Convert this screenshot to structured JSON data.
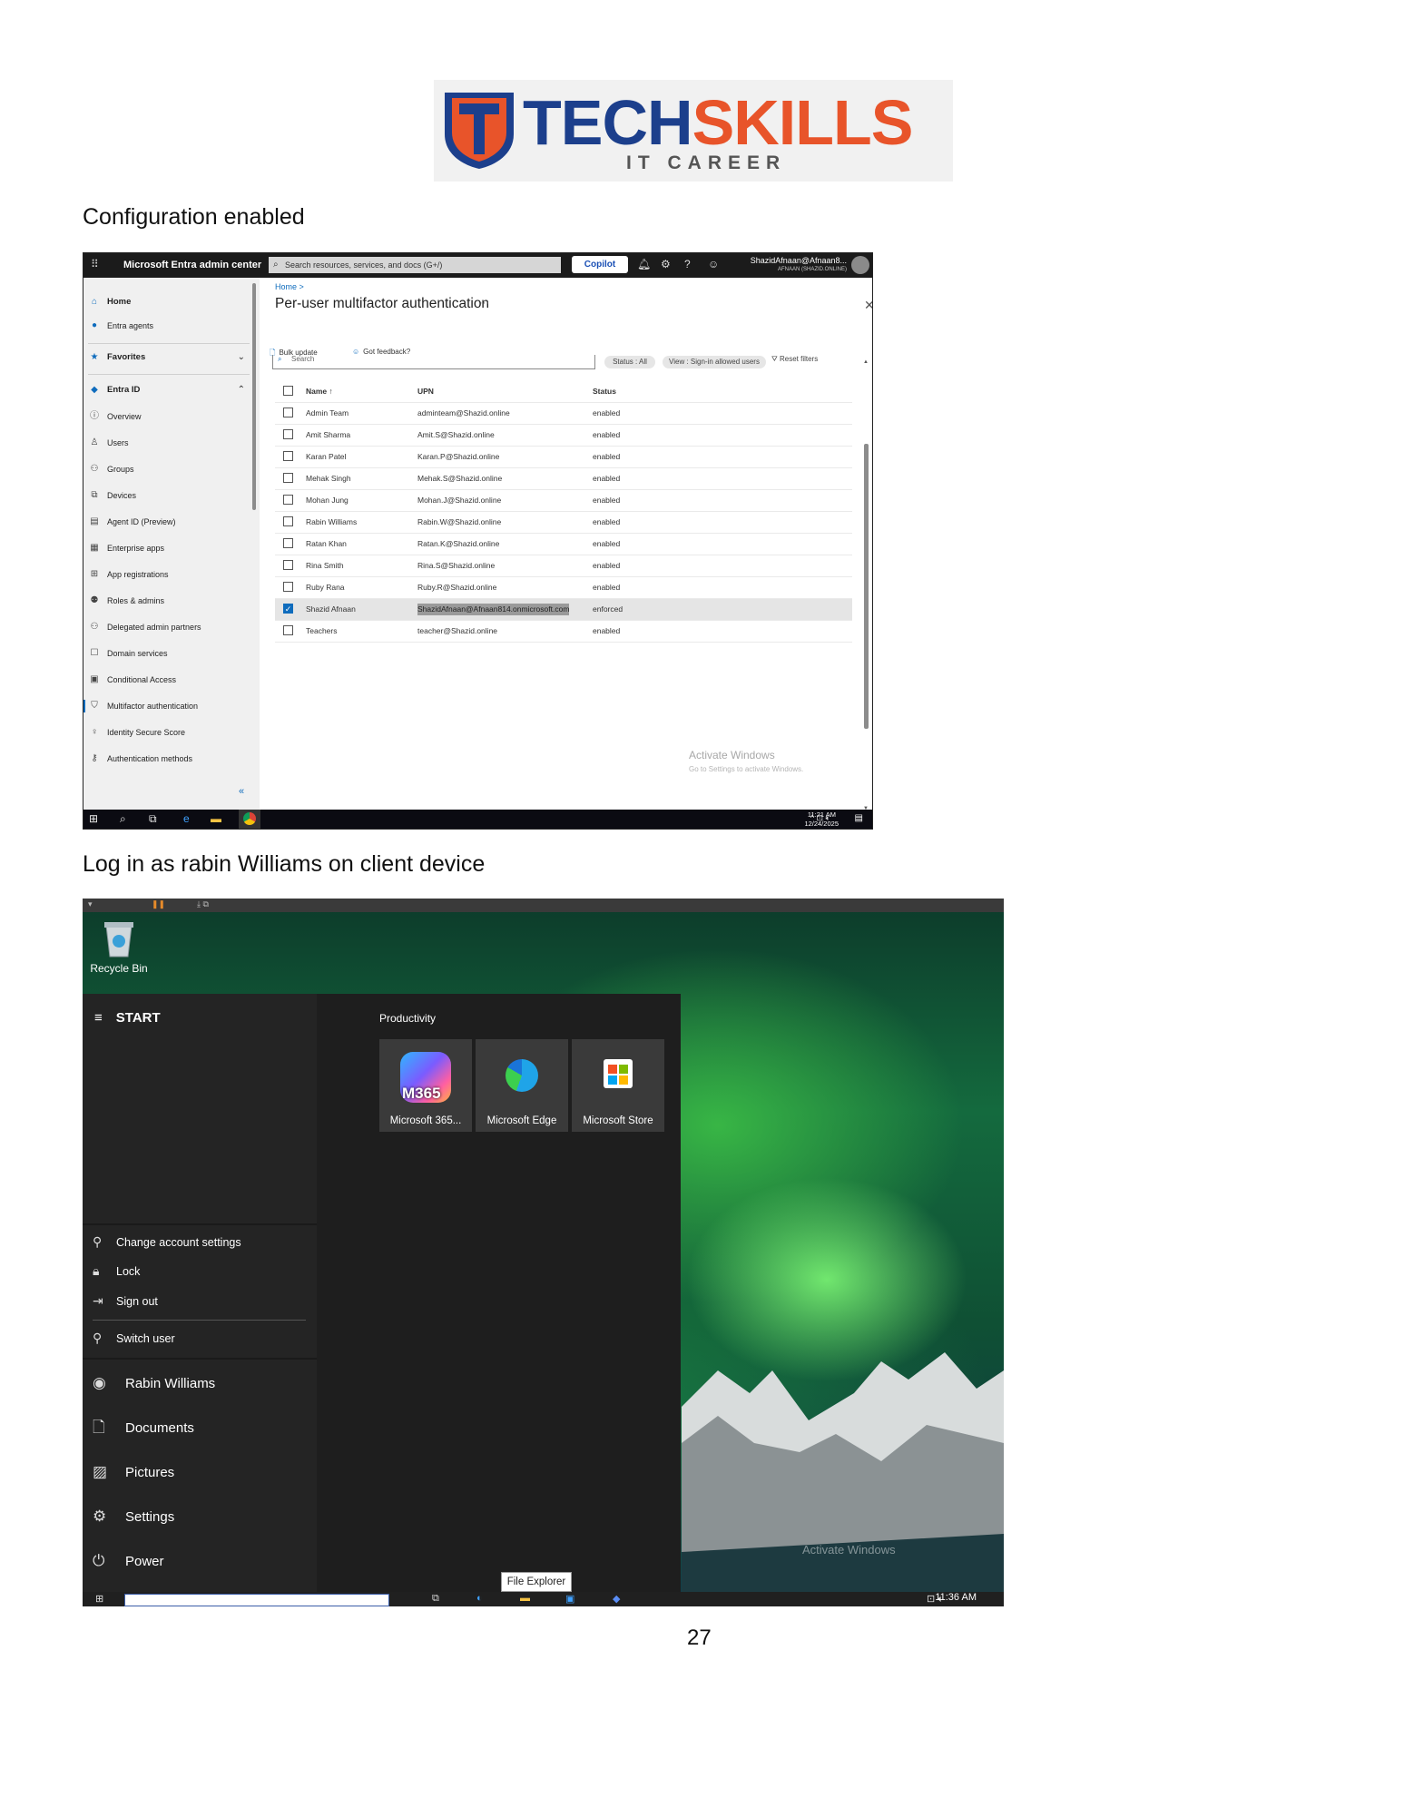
{
  "logo": {
    "word1": "TECH",
    "word2": "SKILLS",
    "tagline": "IT CAREER"
  },
  "heading1": "Configuration enabled",
  "heading2": "Log in as rabin Williams on client device",
  "page_number": "27",
  "entra": {
    "app_title": "Microsoft Entra admin center",
    "search_placeholder": "Search resources, services, and docs (G+/)",
    "copilot_label": "Copilot",
    "account_name": "ShazidAfnaan@Afnaan8...",
    "account_tenant": "AFNAAN (SHAZID.ONLINE)",
    "nav": [
      {
        "label": "Home",
        "icon": "home-icon"
      },
      {
        "label": "Entra agents",
        "icon": "agents-icon"
      },
      {
        "label": "Favorites",
        "icon": "star-icon"
      },
      {
        "label": "Entra ID",
        "icon": "entra-diamond-icon"
      },
      {
        "label": "Overview",
        "icon": "info-icon"
      },
      {
        "label": "Users",
        "icon": "user-icon"
      },
      {
        "label": "Groups",
        "icon": "groups-icon"
      },
      {
        "label": "Devices",
        "icon": "devices-icon"
      },
      {
        "label": "Agent ID (Preview)",
        "icon": "agent-id-icon"
      },
      {
        "label": "Enterprise apps",
        "icon": "enterprise-apps-icon"
      },
      {
        "label": "App registrations",
        "icon": "app-registrations-icon"
      },
      {
        "label": "Roles & admins",
        "icon": "roles-icon"
      },
      {
        "label": "Delegated admin partners",
        "icon": "partners-icon"
      },
      {
        "label": "Domain services",
        "icon": "domain-icon"
      },
      {
        "label": "Conditional Access",
        "icon": "conditional-access-icon"
      },
      {
        "label": "Multifactor authentication",
        "icon": "mfa-icon"
      },
      {
        "label": "Identity Secure Score",
        "icon": "secure-score-icon"
      },
      {
        "label": "Authentication methods",
        "icon": "auth-methods-icon"
      }
    ],
    "breadcrumb": "Home >",
    "page_title": "Per-user multifactor authentication",
    "bulk_update": "Bulk update",
    "got_feedback": "Got feedback?",
    "table_search_placeholder": "Search",
    "filter_status": "Status : All",
    "filter_view": "View : Sign-in allowed users",
    "reset_filters": "Reset filters",
    "columns": {
      "name": "Name ↑",
      "upn": "UPN",
      "status": "Status"
    },
    "rows": [
      {
        "name": "Admin Team",
        "upn": "adminteam@Shazid.online",
        "status": "enabled",
        "checked": false
      },
      {
        "name": "Amit Sharma",
        "upn": "Amit.S@Shazid.online",
        "status": "enabled",
        "checked": false
      },
      {
        "name": "Karan Patel",
        "upn": "Karan.P@Shazid.online",
        "status": "enabled",
        "checked": false
      },
      {
        "name": "Mehak Singh",
        "upn": "Mehak.S@Shazid.online",
        "status": "enabled",
        "checked": false
      },
      {
        "name": "Mohan Jung",
        "upn": "Mohan.J@Shazid.online",
        "status": "enabled",
        "checked": false
      },
      {
        "name": "Rabin Williams",
        "upn": "Rabin.W@Shazid.online",
        "status": "enabled",
        "checked": false
      },
      {
        "name": "Ratan Khan",
        "upn": "Ratan.K@Shazid.online",
        "status": "enabled",
        "checked": false
      },
      {
        "name": "Rina Smith",
        "upn": "Rina.S@Shazid.online",
        "status": "enabled",
        "checked": false
      },
      {
        "name": "Ruby Rana",
        "upn": "Ruby.R@Shazid.online",
        "status": "enabled",
        "checked": false
      },
      {
        "name": "Shazid Afnaan",
        "upn": "ShazidAfnaan@Afnaan814.onmicrosoft.com",
        "status": "enforced",
        "checked": true
      },
      {
        "name": "Teachers",
        "upn": "teacher@Shazid.online",
        "status": "enabled",
        "checked": false
      }
    ],
    "watermark_title": "Activate Windows",
    "watermark_sub": "Go to Settings to activate Windows.",
    "clock_time": "11:21 AM",
    "clock_date": "12/24/2025"
  },
  "desktop": {
    "recycle_bin": "Recycle Bin",
    "start_title": "START",
    "section": "Productivity",
    "tiles": [
      {
        "label": "Microsoft 365...",
        "badge": "M365"
      },
      {
        "label": "Microsoft Edge"
      },
      {
        "label": "Microsoft Store"
      }
    ],
    "account_menu": [
      "Change account settings",
      "Lock",
      "Sign out",
      "Switch user"
    ],
    "user_name": "Rabin Williams",
    "places": [
      "Documents",
      "Pictures",
      "Settings",
      "Power"
    ],
    "tooltip": "File Explorer",
    "clock_time": "11:36 AM"
  }
}
